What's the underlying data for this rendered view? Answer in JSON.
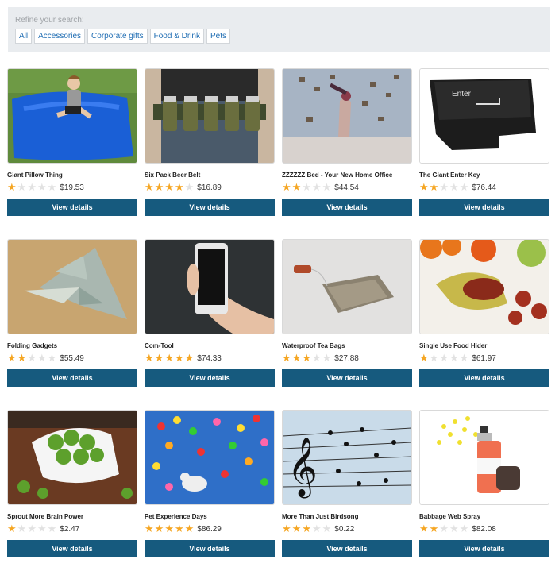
{
  "filter": {
    "label": "Refine your search:",
    "links": [
      "All",
      "Accessories",
      "Corporate gifts",
      "Food & Drink",
      "Pets"
    ]
  },
  "button_label": "View details",
  "colors": {
    "accent": "#165a7e",
    "star": "#f5a623",
    "link": "#1f6db3"
  },
  "products": [
    {
      "name": "Giant Pillow Thing",
      "price": "$19.53",
      "rating": 1,
      "image": "giant-pillow-photo"
    },
    {
      "name": "Six Pack Beer Belt",
      "price": "$16.89",
      "rating": 4,
      "image": "beer-belt-photo"
    },
    {
      "name": "ZZZZZZ Bed - Your New Home Office",
      "price": "$44.54",
      "rating": 2,
      "image": "bed-books-photo"
    },
    {
      "name": "The Giant Enter Key",
      "price": "$76.44",
      "rating": 2,
      "image": "enter-key-photo"
    },
    {
      "name": "Folding Gadgets",
      "price": "$55.49",
      "rating": 2,
      "image": "origami-money-photo"
    },
    {
      "name": "Com-Tool",
      "price": "$74.33",
      "rating": 5,
      "image": "phone-hand-photo"
    },
    {
      "name": "Waterproof Tea Bags",
      "price": "$27.88",
      "rating": 3,
      "image": "tea-bag-photo"
    },
    {
      "name": "Single Use Food Hider",
      "price": "$61.97",
      "rating": 1,
      "image": "food-hider-photo"
    },
    {
      "name": "Sprout More Brain Power",
      "price": "$2.47",
      "rating": 1,
      "image": "sprouts-photo"
    },
    {
      "name": "Pet Experience Days",
      "price": "$86.29",
      "rating": 5,
      "image": "pet-balloons-photo"
    },
    {
      "name": "More Than Just Birdsong",
      "price": "$0.22",
      "rating": 3,
      "image": "birds-wires-photo"
    },
    {
      "name": "Babbage Web Spray",
      "price": "$82.08",
      "rating": 2,
      "image": "spray-can-photo"
    }
  ]
}
